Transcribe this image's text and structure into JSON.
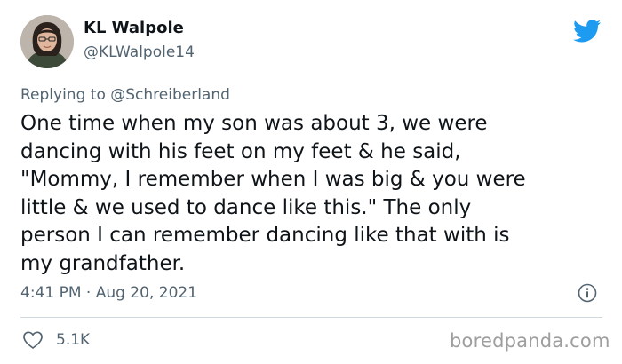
{
  "author": {
    "display_name": "KL Walpole",
    "handle": "@KLWalpole14"
  },
  "reply": {
    "prefix": "Replying to ",
    "mention": "@Schreiberland"
  },
  "tweet": {
    "text": "One time when my son was about 3, we were\ndancing with his feet on my feet & he said,\n\"Mommy, I remember when I was big & you were\nlittle & we used to dance like this.\" The only\nperson I can remember dancing like that with is\nmy grandfather.",
    "timestamp": "4:41 PM · Aug 20, 2021"
  },
  "engagement": {
    "likes": "5.1K"
  },
  "watermark": "boredpanda.com",
  "icons": {
    "brand": "twitter-bird-icon",
    "info": "info-icon",
    "like": "heart-icon"
  },
  "colors": {
    "twitter_blue": "#1d9bf0",
    "secondary_text": "#536471",
    "primary_text": "#0f1419",
    "divider": "#cfd9de",
    "watermark": "#9e9e9e"
  }
}
